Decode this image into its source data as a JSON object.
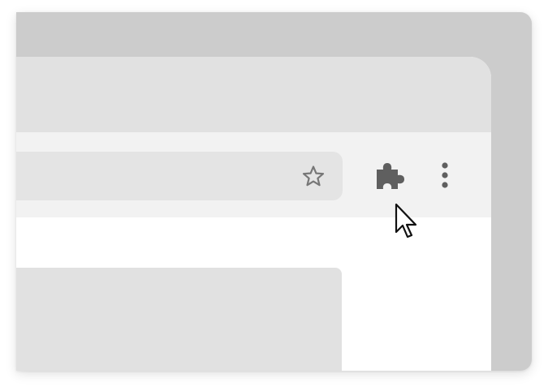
{
  "window": {
    "icons": {
      "bookmark": "star-outline",
      "extensions": "puzzle-piece",
      "menu": "vertical-ellipsis",
      "pointer": "mouse-cursor-arrow"
    }
  },
  "colors": {
    "frame": "#cccccc",
    "tabstrip": "#e1e1e1",
    "toolbar": "#f2f2f2",
    "omnibox": "#e4e4e4",
    "icon": "#5f5f5f",
    "content": "#ffffff"
  }
}
